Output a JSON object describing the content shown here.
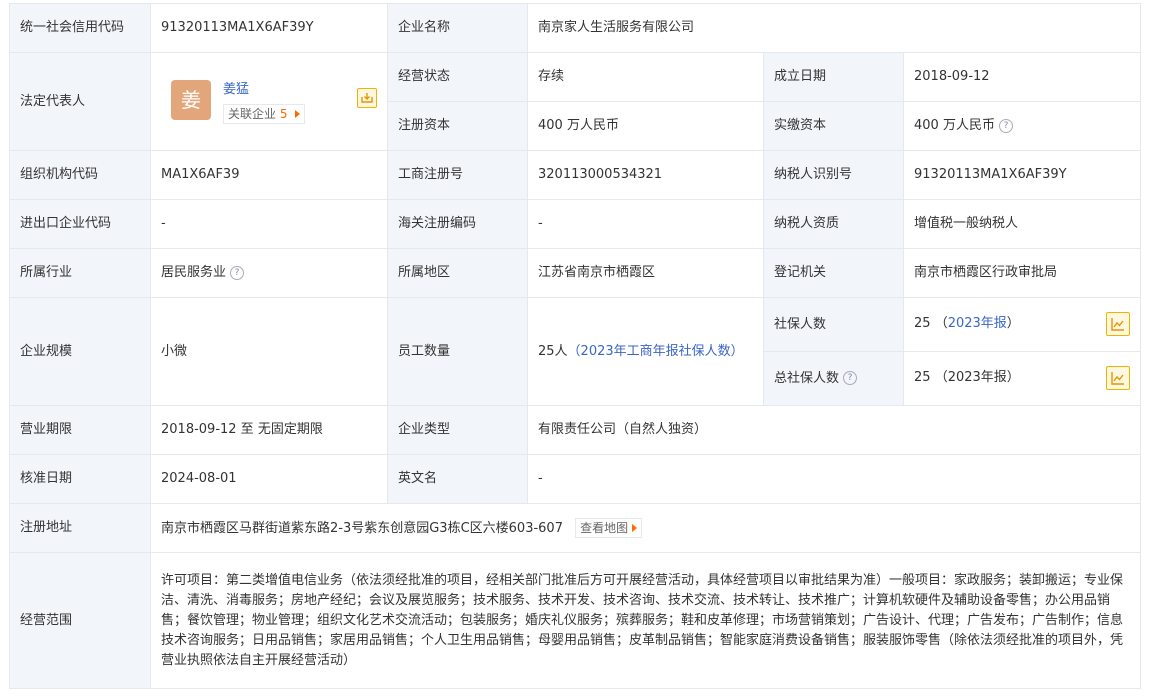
{
  "rows": {
    "credit_code": {
      "label": "统一社会信用代码",
      "value": "91320113MA1X6AF39Y"
    },
    "company_name": {
      "label": "企业名称",
      "value": "南京家人生活服务有限公司"
    },
    "legal_rep": {
      "label": "法定代表人",
      "avatar_char": "姜",
      "name": "姜猛",
      "related_label": "关联企业",
      "related_count": "5"
    },
    "status": {
      "label": "经营状态",
      "value": "存续"
    },
    "founded": {
      "label": "成立日期",
      "value": "2018-09-12"
    },
    "reg_capital": {
      "label": "注册资本",
      "value": "400 万人民币"
    },
    "paid_capital": {
      "label": "实缴资本",
      "value": "400 万人民币"
    },
    "org_code": {
      "label": "组织机构代码",
      "value": "MA1X6AF39"
    },
    "biz_reg_no": {
      "label": "工商注册号",
      "value": "320113000534321"
    },
    "taxpayer_id": {
      "label": "纳税人识别号",
      "value": "91320113MA1X6AF39Y"
    },
    "import_export": {
      "label": "进出口企业代码",
      "value": "-"
    },
    "customs": {
      "label": "海关注册编码",
      "value": "-"
    },
    "taxpayer_qual": {
      "label": "纳税人资质",
      "value": "增值税一般纳税人"
    },
    "industry": {
      "label": "所属行业",
      "value": "居民服务业"
    },
    "region": {
      "label": "所属地区",
      "value": "江苏省南京市栖霞区"
    },
    "authority": {
      "label": "登记机关",
      "value": "南京市栖霞区行政审批局"
    },
    "scale": {
      "label": "企业规模",
      "value": "小微"
    },
    "staff": {
      "label": "员工数量",
      "value": "25人",
      "note": "（2023年工商年报社保人数）"
    },
    "social_ins": {
      "label": "社保人数",
      "value": "25",
      "year": "2023年报"
    },
    "total_social_ins": {
      "label": "总社保人数",
      "value": "25",
      "year": "（2023年报）"
    },
    "term": {
      "label": "营业期限",
      "value": "2018-09-12 至 无固定期限"
    },
    "type": {
      "label": "企业类型",
      "value": "有限责任公司（自然人独资）"
    },
    "approved": {
      "label": "核准日期",
      "value": "2024-08-01"
    },
    "en_name": {
      "label": "英文名",
      "value": "-"
    },
    "address": {
      "label": "注册地址",
      "value": "南京市栖霞区马群街道紫东路2-3号紫东创意园G3栋C区六楼603-607",
      "map_label": "查看地图"
    },
    "scope": {
      "label": "经营范围",
      "value": "许可项目：第二类增值电信业务（依法须经批准的项目，经相关部门批准后方可开展经营活动，具体经营项目以审批结果为准）一般项目：家政服务；装卸搬运；专业保洁、清洗、消毒服务；房地产经纪；会议及展览服务；技术服务、技术开发、技术咨询、技术交流、技术转让、技术推广；计算机软硬件及辅助设备零售；办公用品销售；餐饮管理；物业管理；组织文化艺术交流活动；包装服务；婚庆礼仪服务；殡葬服务；鞋和皮革修理；市场营销策划；广告设计、代理；广告发布；广告制作；信息技术咨询服务；日用品销售；家居用品销售；个人卫生用品销售；母婴用品销售；皮革制品销售；智能家庭消费设备销售；服装服饰零售（除依法须经批准的项目外，凭营业执照依法自主开展经营活动）"
    }
  },
  "icons": {
    "hint": "question-circle-icon",
    "share": "share-icon",
    "chart": "trend-chart-icon",
    "arrow": "caret-right-icon"
  },
  "colors": {
    "label_bg": "#f2f5fa",
    "border": "#e4e8ef",
    "link": "#3966c8",
    "accent": "#ff6a00",
    "avatar": "#e3a57a"
  }
}
